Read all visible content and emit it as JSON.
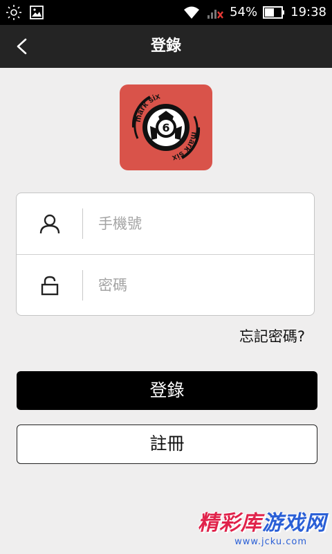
{
  "status_bar": {
    "battery": "54%",
    "time": "19:38"
  },
  "app_bar": {
    "title": "登錄"
  },
  "logo": {
    "text_top": "mark six",
    "text_bottom": "mark six",
    "ball_number": "6"
  },
  "form": {
    "phone_placeholder": "手機號",
    "password_placeholder": "密碼",
    "phone_value": "",
    "password_value": ""
  },
  "forgot_password": "忘記密碼?",
  "buttons": {
    "login": "登錄",
    "register": "註冊"
  },
  "watermark": {
    "title_part1": "精彩库",
    "title_part2": "游戏网",
    "url": "www.jcku.com"
  },
  "colors": {
    "logo_bg": "#d9534a",
    "app_bar": "#242424",
    "page_bg": "#efeeee"
  }
}
